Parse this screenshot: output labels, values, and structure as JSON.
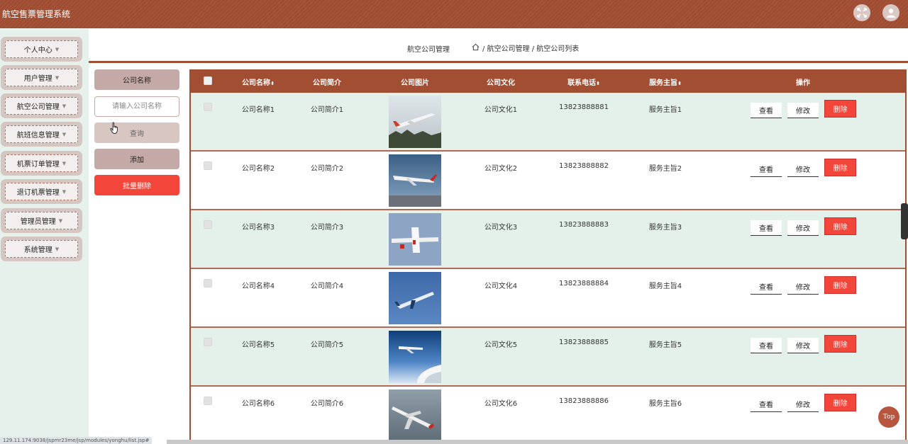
{
  "app": {
    "title": "航空售票管理系统"
  },
  "header": {
    "icons": [
      "fullscreen-icon",
      "user-avatar-icon"
    ]
  },
  "sidebar": {
    "items": [
      {
        "label": "个人中心"
      },
      {
        "label": "用户管理"
      },
      {
        "label": "航空公司管理"
      },
      {
        "label": "航班信息管理"
      },
      {
        "label": "机票订单管理"
      },
      {
        "label": "退订机票管理"
      },
      {
        "label": "管理员管理"
      },
      {
        "label": "系统管理"
      }
    ],
    "caret": "▼"
  },
  "breadcrumb": {
    "title": "航空公司管理",
    "path": "/ 航空公司管理 / 航空公司列表"
  },
  "search": {
    "label": "公司名称",
    "placeholder": "请输入公司名称",
    "query_label": "查询",
    "add_label": "添加",
    "batch_delete_label": "批量删除"
  },
  "table": {
    "columns": [
      "公司名称",
      "公司简介",
      "公司图片",
      "公司文化",
      "联系电话",
      "服务主旨",
      "操作"
    ],
    "rows": [
      {
        "name": "公司名称1",
        "intro": "公司简介1",
        "culture": "公司文化1",
        "phone": "13823888881",
        "purpose": "服务主旨1"
      },
      {
        "name": "公司名称2",
        "intro": "公司简介2",
        "culture": "公司文化2",
        "phone": "13823888882",
        "purpose": "服务主旨2"
      },
      {
        "name": "公司名称3",
        "intro": "公司简介3",
        "culture": "公司文化3",
        "phone": "13823888883",
        "purpose": "服务主旨3"
      },
      {
        "name": "公司名称4",
        "intro": "公司简介4",
        "culture": "公司文化4",
        "phone": "13823888884",
        "purpose": "服务主旨4"
      },
      {
        "name": "公司名称5",
        "intro": "公司简介5",
        "culture": "公司文化5",
        "phone": "13823888885",
        "purpose": "服务主旨5"
      },
      {
        "name": "公司名称6",
        "intro": "公司简介6",
        "culture": "公司文化6",
        "phone": "13823888886",
        "purpose": "服务主旨6"
      }
    ],
    "actions": {
      "view": "查看",
      "edit": "修改",
      "delete": "删除"
    },
    "sort_glyph": "⬍"
  },
  "footer": {
    "top_label": "Top",
    "status_url": "129.11.174:9038/jspmr23me/jsp/modules/yonghu/list.jsp#"
  },
  "colors": {
    "brand": "#a24e33",
    "sidebar_bg": "#e7f1ec",
    "danger": "#f2463a",
    "row_alt": "#e4f0ea"
  }
}
